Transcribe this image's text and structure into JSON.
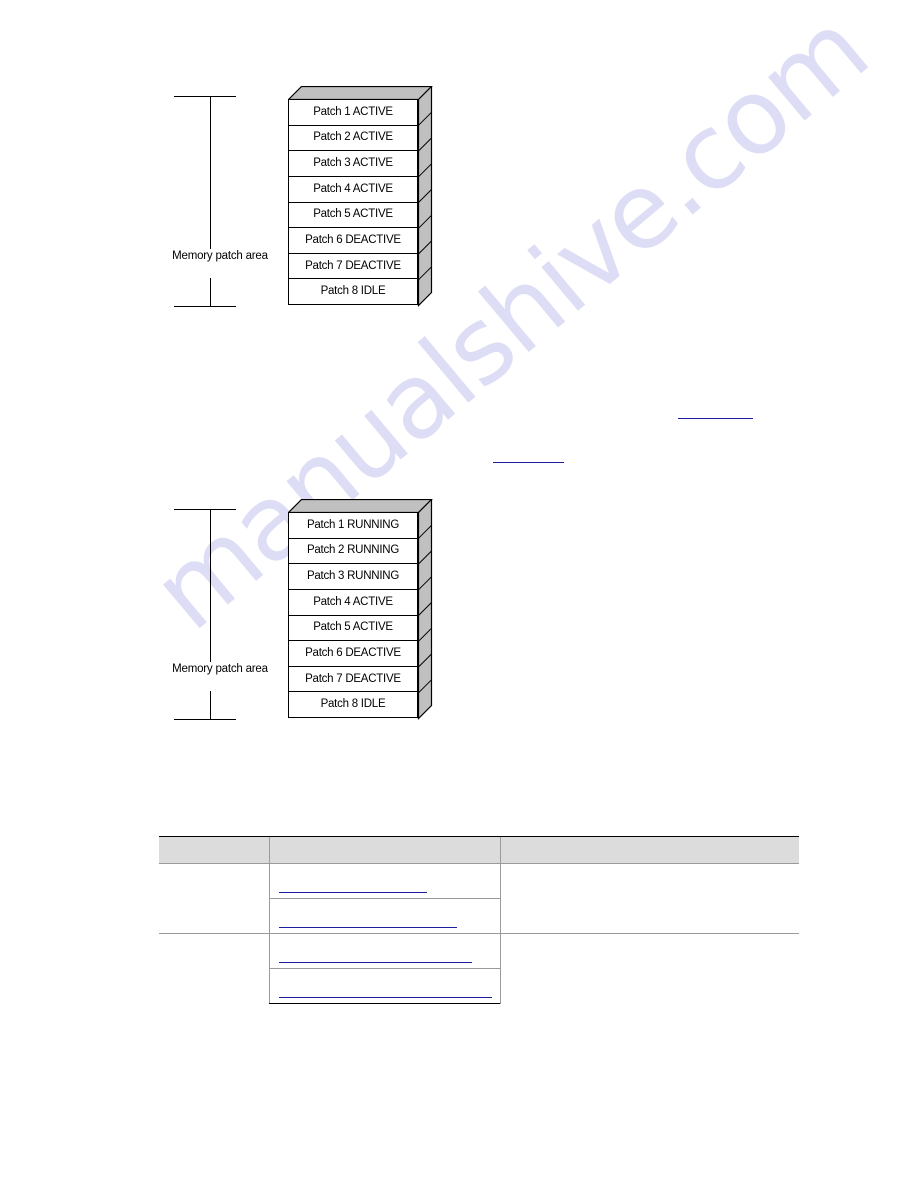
{
  "document": {
    "watermark": "manualshive.com",
    "link_color": "#1d1da0",
    "stack_face_color": "#c0c0c0",
    "table_header_color": "#dcdcdc"
  },
  "figures": [
    {
      "id": "figure-1",
      "bracket_label": "Memory patch area",
      "rows": [
        "Patch 1 ACTIVE",
        "Patch 2 ACTIVE",
        "Patch 3 ACTIVE",
        "Patch 4 ACTIVE",
        "Patch 5 ACTIVE",
        "Patch 6 DEACTIVE",
        "Patch 7 DEACTIVE",
        "Patch 8 IDLE"
      ]
    },
    {
      "id": "figure-2",
      "bracket_label": "Memory patch area",
      "rows": [
        "Patch 1 RUNNING",
        "Patch 2 RUNNING",
        "Patch 3 RUNNING",
        "Patch 4 ACTIVE",
        "Patch 5 ACTIVE",
        "Patch 6 DEACTIVE",
        "Patch 7 DEACTIVE",
        "Patch 8 IDLE"
      ]
    }
  ],
  "body_links": [
    {
      "id": "link-body-1",
      "text": ""
    },
    {
      "id": "link-body-2",
      "text": ""
    }
  ],
  "table": {
    "headers": [
      "",
      "",
      ""
    ],
    "rows": [
      {
        "col_a": "",
        "col_b": "",
        "col_c": "",
        "link_width": 148
      },
      {
        "col_a": "",
        "col_b": "",
        "col_c": "",
        "link_width": 178
      },
      {
        "col_a": "",
        "col_b": "",
        "col_c": "",
        "link_width": 193
      },
      {
        "col_a": "",
        "col_b": "",
        "col_c": "",
        "link_width": 213
      }
    ]
  }
}
